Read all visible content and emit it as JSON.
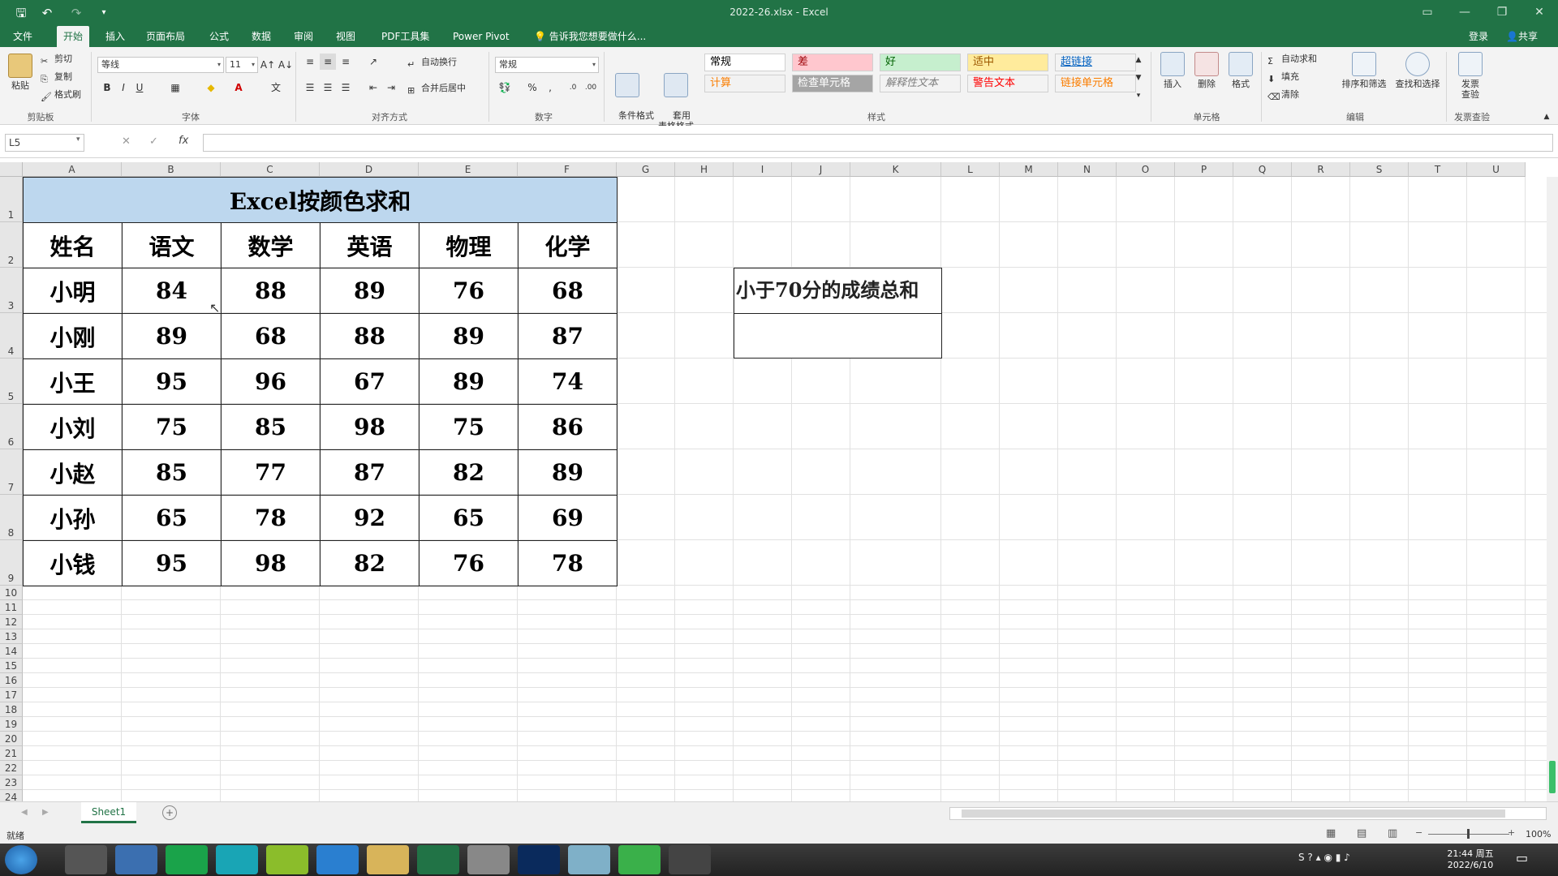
{
  "window": {
    "title": "2022-26.xlsx - Excel",
    "login": "登录",
    "share": "共享"
  },
  "tabs": [
    "文件",
    "开始",
    "插入",
    "页面布局",
    "公式",
    "数据",
    "审阅",
    "视图",
    "PDF工具集",
    "Power Pivot"
  ],
  "tellme": "告诉我您想要做什么...",
  "ribbon": {
    "clipboard": {
      "paste": "粘贴",
      "cut": "剪切",
      "copy": "复制",
      "format_painter": "格式刷",
      "label": "剪贴板"
    },
    "font": {
      "name": "等线",
      "size": "11",
      "label": "字体"
    },
    "align": {
      "wrap": "自动换行",
      "merge": "合并后居中",
      "label": "对齐方式"
    },
    "number": {
      "format": "常规",
      "label": "数字"
    },
    "styles": {
      "cond": "条件格式",
      "table": "套用\n表格格式",
      "label": "样式",
      "cells": [
        {
          "text": "常规",
          "bg": "#ffffff",
          "color": "#000000"
        },
        {
          "text": "差",
          "bg": "#ffc7ce",
          "color": "#9c0006"
        },
        {
          "text": "好",
          "bg": "#c6efce",
          "color": "#006100"
        },
        {
          "text": "适中",
          "bg": "#ffeb9c",
          "color": "#9c5700"
        },
        {
          "text": "超链接",
          "bg": "#f3f3f3",
          "color": "#0563c1"
        },
        {
          "text": "计算",
          "bg": "#f2f2f2",
          "color": "#fa7d00"
        },
        {
          "text": "检查单元格",
          "bg": "#a5a5a5",
          "color": "#ffffff"
        },
        {
          "text": "解释性文本",
          "bg": "#f3f3f3",
          "color": "#7f7f7f"
        },
        {
          "text": "警告文本",
          "bg": "#f3f3f3",
          "color": "#ff0000"
        },
        {
          "text": "链接单元格",
          "bg": "#f3f3f3",
          "color": "#fa7d00"
        }
      ]
    },
    "cells": {
      "insert": "插入",
      "delete": "删除",
      "format": "格式",
      "label": "单元格"
    },
    "edit": {
      "autosum": "自动求和",
      "fill": "填充",
      "clear": "清除",
      "sort": "排序和筛选",
      "find": "查找和选择",
      "label": "编辑"
    },
    "invoice": {
      "check": "发票\n查验",
      "label": "发票查验"
    }
  },
  "namebox": "L5",
  "columns": [
    "A",
    "B",
    "C",
    "D",
    "E",
    "F",
    "G",
    "H",
    "I",
    "J",
    "K",
    "L",
    "M",
    "N",
    "O",
    "P",
    "Q",
    "R",
    "S",
    "T",
    "U"
  ],
  "rows": [
    "1",
    "2",
    "3",
    "4",
    "5",
    "6",
    "7",
    "8",
    "9",
    "10",
    "11",
    "12",
    "13",
    "14",
    "15",
    "16",
    "17",
    "18",
    "19",
    "20",
    "21",
    "22",
    "23",
    "24"
  ],
  "sheet": {
    "title": "Excel按颜色求和",
    "headers": [
      "姓名",
      "语文",
      "数学",
      "英语",
      "物理",
      "化学"
    ],
    "records": [
      [
        "小明",
        "84",
        "88",
        "89",
        "76",
        "68"
      ],
      [
        "小刚",
        "89",
        "68",
        "88",
        "89",
        "87"
      ],
      [
        "小王",
        "95",
        "96",
        "67",
        "89",
        "74"
      ],
      [
        "小刘",
        "75",
        "85",
        "98",
        "75",
        "86"
      ],
      [
        "小赵",
        "85",
        "77",
        "87",
        "82",
        "89"
      ],
      [
        "小孙",
        "65",
        "78",
        "92",
        "65",
        "69"
      ],
      [
        "小钱",
        "95",
        "98",
        "82",
        "76",
        "78"
      ]
    ],
    "side_label": "小于70分的成绩总和",
    "side_value": ""
  },
  "sheet_tab": "Sheet1",
  "status": {
    "ready": "就绪",
    "zoom": "100%"
  },
  "clock": {
    "time": "21:44 周五",
    "date": "2022/6/10"
  }
}
